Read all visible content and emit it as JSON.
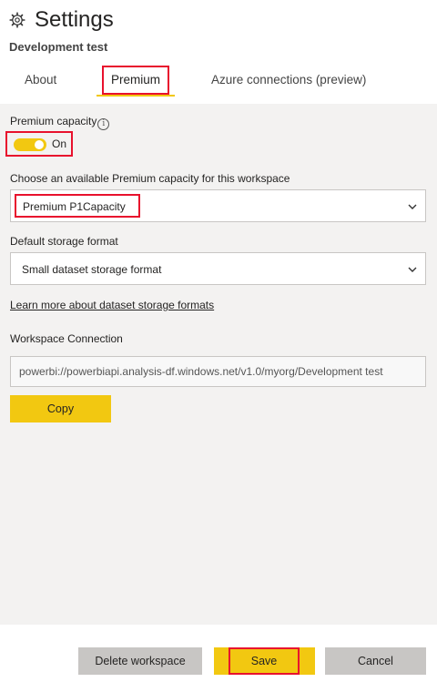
{
  "header": {
    "title": "Settings",
    "subtitle": "Development test",
    "icon": "gear-icon"
  },
  "tabs": [
    {
      "label": "About"
    },
    {
      "label": "Premium",
      "selected": true
    },
    {
      "label": "Azure connections (preview)"
    }
  ],
  "premium": {
    "capacity_label": "Premium capacity",
    "info_glyph": "i",
    "toggle_state": "On",
    "choose_label": "Choose an available Premium capacity for this workspace",
    "capacity_value": "Premium  P1Capacity",
    "storage_label": "Default storage format",
    "storage_value": "Small dataset storage format",
    "learn_more": "Learn more about dataset storage formats",
    "connection_label": "Workspace Connection",
    "connection_value": "powerbi://powerbiapi.analysis-df.windows.net/v1.0/myorg/Development test",
    "copy_label": "Copy"
  },
  "footer": {
    "delete_label": "Delete workspace",
    "save_label": "Save",
    "cancel_label": "Cancel"
  },
  "colors": {
    "accent": "#f2c811",
    "highlight": "#e8112d",
    "panel": "#f3f2f1",
    "button_gray": "#c8c6c4"
  }
}
